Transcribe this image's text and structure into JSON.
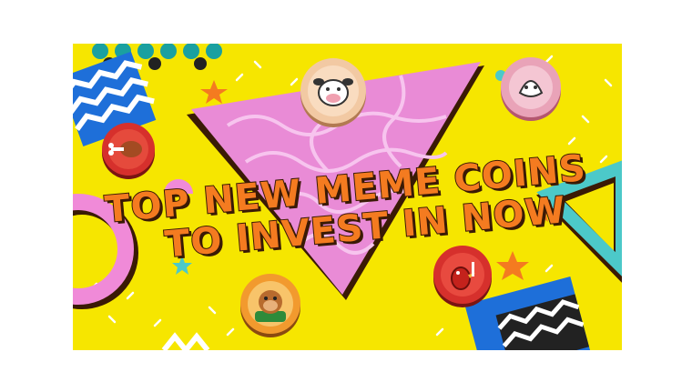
{
  "banner": {
    "headline_line1": "TOP NEW MEME COINS",
    "headline_line2": "TO INVEST IN NOW",
    "colors": {
      "background": "#f6e600",
      "triangle": "#e98bd6",
      "text_fill": "#f47b20",
      "text_outline": "#3a1a05",
      "teal": "#4cc9c9",
      "blue": "#1e6fd9"
    }
  },
  "coins": [
    {
      "name": "cow-coin-icon",
      "color": "#f2c9a3"
    },
    {
      "name": "pink-face-coin-icon",
      "color": "#e9a3b8"
    },
    {
      "name": "meat-coin-icon",
      "color": "#d6302c"
    },
    {
      "name": "bird-coin-icon",
      "color": "#d6302c"
    },
    {
      "name": "monkey-coin-icon",
      "color": "#f29a2e"
    }
  ]
}
